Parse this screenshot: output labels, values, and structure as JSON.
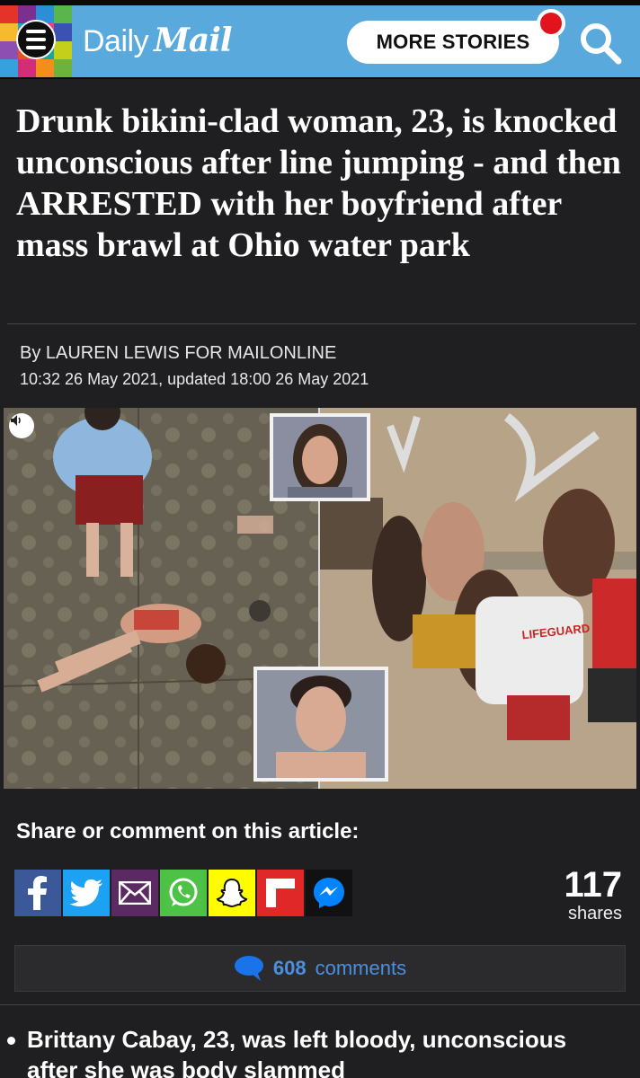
{
  "header": {
    "logo_daily": "Daily",
    "logo_mail": "Mail",
    "more_stories": "MORE STORIES",
    "mosaic_colors": [
      "#e5332a",
      "#7b2f8e",
      "#2b8fd6",
      "#5ab64c",
      "#f7b92d",
      "#1fa3c6",
      "#e4467a",
      "#3b52b3",
      "#8d4fb2",
      "#e65124",
      "#1da39a",
      "#c4cf1c",
      "#36a1dc",
      "#d22e78",
      "#f28e1c",
      "#6cb33e"
    ],
    "accent_color": "#5aa9dc"
  },
  "article": {
    "headline": "Drunk bikini-clad woman, 23, is knocked unconscious after line jumping - and then ARRESTED with her boyfriend after mass brawl at Ohio water park",
    "byline": "By LAUREN LEWIS FOR MAILONLINE",
    "dateline": "10:32 26 May 2021, updated 18:00 26 May 2021",
    "hero_lifeguard_text": "LIFEGUARD"
  },
  "share": {
    "title": "Share or comment on this article:",
    "buttons": [
      {
        "name": "facebook",
        "color": "#3b5998"
      },
      {
        "name": "twitter",
        "color": "#1da1f2"
      },
      {
        "name": "email",
        "color": "#5c2a63"
      },
      {
        "name": "whatsapp",
        "color": "#4dc247"
      },
      {
        "name": "snapchat",
        "color": "#fffc00"
      },
      {
        "name": "flipboard",
        "color": "#e12828"
      },
      {
        "name": "messenger",
        "color": "#0084ff"
      }
    ],
    "count": "117",
    "count_label": "shares"
  },
  "comments": {
    "count": "608",
    "label": "comments"
  },
  "bullets": [
    "Brittany Cabay, 23, was left bloody, unconscious after she was body slammed"
  ]
}
